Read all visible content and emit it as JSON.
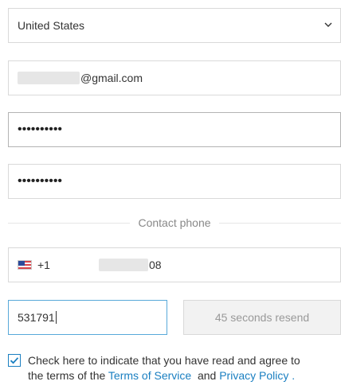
{
  "country": {
    "selected": "United States"
  },
  "email": {
    "visible_suffix": "@gmail.com"
  },
  "password": {
    "masked": "••••••••••"
  },
  "confirm_password": {
    "masked": "••••••••••"
  },
  "contact_phone": {
    "label": "Contact phone",
    "dial_code": "+1",
    "visible_suffix": "08"
  },
  "verification": {
    "code_value": "531791",
    "resend_label": "45 seconds resend"
  },
  "agreement": {
    "checked": true,
    "line1": "Check here to indicate that you have read and agree to",
    "prefix": "the terms of the",
    "terms_link": "Terms of Service",
    "and": "and",
    "privacy_link": "Privacy Policy",
    "suffix": "."
  },
  "colors": {
    "link": "#1a7fc1",
    "focus_border": "#58a9d9",
    "border": "#d9d9d9"
  },
  "icons": {
    "country_dropdown": "chevron-down-icon",
    "flag": "us-flag-icon",
    "checkbox": "checkmark-icon"
  }
}
